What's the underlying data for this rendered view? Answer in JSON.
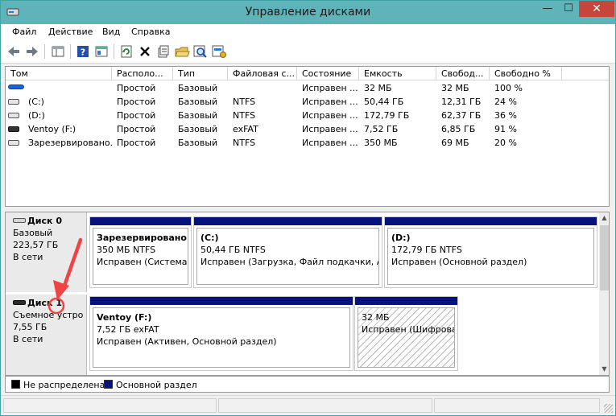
{
  "window": {
    "title": "Управление дисками",
    "min": "—",
    "max": "☐",
    "close": "✕"
  },
  "menu": [
    "Файл",
    "Действие",
    "Вид",
    "Справка"
  ],
  "table": {
    "headers": [
      "Том",
      "Располо...",
      "Тип",
      "Файловая с...",
      "Состояние",
      "Емкость",
      "Свобод...",
      "Свободно %"
    ],
    "rows": [
      {
        "icon": "blue-volume-icon",
        "name": "",
        "layout": "Простой",
        "type": "Базовый",
        "fs": "",
        "status": "Исправен ...",
        "capacity": "32 МБ",
        "free": "32 МБ",
        "free_pct": "100 %"
      },
      {
        "icon": "hdd-icon",
        "name": "(C:)",
        "layout": "Простой",
        "type": "Базовый",
        "fs": "NTFS",
        "status": "Исправен ...",
        "capacity": "50,44 ГБ",
        "free": "12,31 ГБ",
        "free_pct": "24 %"
      },
      {
        "icon": "hdd-icon",
        "name": "(D:)",
        "layout": "Простой",
        "type": "Базовый",
        "fs": "NTFS",
        "status": "Исправен ...",
        "capacity": "172,79 ГБ",
        "free": "62,37 ГБ",
        "free_pct": "36 %"
      },
      {
        "icon": "usb-drive-icon",
        "name": "Ventoy (F:)",
        "layout": "Простой",
        "type": "Базовый",
        "fs": "exFAT",
        "status": "Исправен ...",
        "capacity": "7,52 ГБ",
        "free": "6,85 ГБ",
        "free_pct": "91 %"
      },
      {
        "icon": "hdd-icon",
        "name": "Зарезервировано...",
        "layout": "Простой",
        "type": "Базовый",
        "fs": "NTFS",
        "status": "Исправен ...",
        "capacity": "350 МБ",
        "free": "69 МБ",
        "free_pct": "20 %"
      }
    ]
  },
  "disks": [
    {
      "label": "Диск 0",
      "kind": "Базовый",
      "size": "223,57 ГБ",
      "state": "В сети",
      "partitions": [
        {
          "title": "Зарезервировано с",
          "line2": "350 МБ NTFS",
          "line3": "Исправен (Система, "
        },
        {
          "title": "(C:)",
          "line2": "50,44 ГБ NTFS",
          "line3": "Исправен (Загрузка, Файл подкачки, Ава"
        },
        {
          "title": "(D:)",
          "line2": "172,79 ГБ NTFS",
          "line3": "Исправен (Основной раздел)"
        }
      ]
    },
    {
      "label": "Диск 1",
      "kind": "Съемное устро",
      "size": "7,55 ГБ",
      "state": "В сети",
      "partitions": [
        {
          "title": "Ventoy  (F:)",
          "line2": "7,52 ГБ exFAT",
          "line3": "Исправен (Активен, Основной раздел)"
        },
        {
          "title": "",
          "line2": "32 МБ",
          "line3": "Исправен (Шифрова"
        }
      ]
    }
  ],
  "legend": [
    {
      "label": "Не распределена",
      "color": "#000000"
    },
    {
      "label": "Основной раздел",
      "color": "#08127d"
    }
  ],
  "colors": {
    "titlebar": "#5fb4b9",
    "primary_partition": "#08127d",
    "annotation": "#ef4444"
  }
}
